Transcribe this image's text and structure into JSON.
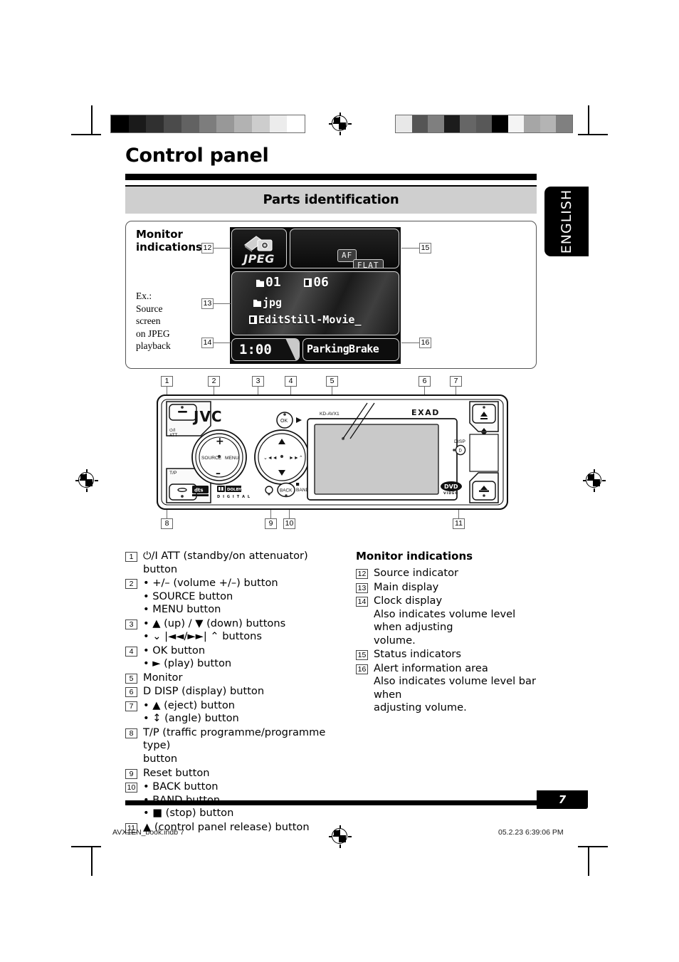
{
  "page": {
    "title": "Control panel",
    "section_band": "Parts identification",
    "language_tab": "ENGLISH",
    "page_number": "7"
  },
  "footer": {
    "file_label": "AVX1EN_book.indb   7",
    "timestamp": "05.2.23   6:39:06 PM"
  },
  "calibration": {
    "left_bar": [
      "#000000",
      "#1a1a1a",
      "#303030",
      "#4b4b4b",
      "#626262",
      "#7d7d7d",
      "#989898",
      "#b2b2b2",
      "#cdcdcd",
      "#ececec",
      "#ffffff"
    ],
    "right_bar": [
      "#e8e8e8",
      "#555555",
      "#7f7f7f",
      "#1c1c1c",
      "#666666",
      "#585858",
      "#000000",
      "#f4f4f4",
      "#a6a6a6",
      "#b4b4b4",
      "#808080"
    ]
  },
  "monitor_panel": {
    "heading_line1": "Monitor",
    "heading_line2": "indications",
    "example_lines": [
      "Ex.:",
      "Source",
      "screen",
      "on JPEG",
      "playback"
    ],
    "lcd": {
      "source_indicator": "JPEG",
      "status_badges": [
        "AF",
        "FLAT"
      ],
      "main_folder_number": "01",
      "main_file_number": "06",
      "main_folder_name": "jpg",
      "main_file_name": "EditStill-Movie_",
      "clock": "1:00",
      "alert": "ParkingBrake"
    },
    "callouts": [
      "12",
      "13",
      "14",
      "15",
      "16"
    ]
  },
  "faceplate": {
    "brand": "JVC",
    "model": "KD-AVX1",
    "submark": "EXAD",
    "knob_left_labels": {
      "plus": "+",
      "minus": "–",
      "source": "SOURCE",
      "menu": "MENU"
    },
    "knob_right_labels": {
      "prev": "⌄ |◄◄",
      "next": "►►| ⌃"
    },
    "ok_label": "OK",
    "play_label": "►",
    "disp_label": "DISP",
    "back_label": "BACK",
    "band_label": "BAND",
    "stop_label": "■",
    "power_label_line1": "⏻/I",
    "power_label_line2": "ATT",
    "tp_label": "T/P",
    "logo_dts": "dts",
    "logo_dolby_line1": "DOLBY",
    "logo_dolby_line2": "D I G I T A L",
    "logo_dvd_line1": "DVD",
    "logo_dvd_line2": "VIDEO",
    "callouts": [
      "1",
      "2",
      "3",
      "4",
      "5",
      "6",
      "7",
      "8",
      "9",
      "10",
      "11"
    ]
  },
  "legend_left": [
    {
      "num": "1",
      "lines": [
        "⏻/I ATT (standby/on attenuator) button"
      ]
    },
    {
      "num": "2",
      "lines": [
        "• +/– (volume +/–) button",
        "• SOURCE button",
        "• MENU button"
      ]
    },
    {
      "num": "3",
      "lines": [
        "• ▲ (up) / ▼ (down) buttons",
        "• ⌄ |◄◄/►►| ⌃ buttons"
      ]
    },
    {
      "num": "4",
      "lines": [
        "• OK button",
        "• ► (play) button"
      ]
    },
    {
      "num": "5",
      "lines": [
        "Monitor"
      ]
    },
    {
      "num": "6",
      "lines": [
        "D DISP (display) button"
      ]
    },
    {
      "num": "7",
      "lines": [
        "• ▲ (eject) button",
        "• ↕ (angle) button"
      ]
    },
    {
      "num": "8",
      "lines": [
        "T/P (traffic programme/programme type)",
        "button"
      ]
    },
    {
      "num": "9",
      "lines": [
        "Reset button"
      ]
    },
    {
      "num": "10",
      "lines": [
        "• BACK button",
        "• BAND button",
        "• ■ (stop) button"
      ]
    },
    {
      "num": "11",
      "lines": [
        "▲ (control panel release) button"
      ]
    }
  ],
  "legend_right": {
    "heading": "Monitor indications",
    "items": [
      {
        "num": "12",
        "lines": [
          "Source indicator"
        ]
      },
      {
        "num": "13",
        "lines": [
          "Main display"
        ]
      },
      {
        "num": "14",
        "lines": [
          "Clock display",
          "Also indicates volume level when adjusting",
          "volume."
        ]
      },
      {
        "num": "15",
        "lines": [
          "Status indicators"
        ]
      },
      {
        "num": "16",
        "lines": [
          "Alert information area",
          "Also indicates volume level bar when",
          "adjusting volume."
        ]
      }
    ]
  }
}
